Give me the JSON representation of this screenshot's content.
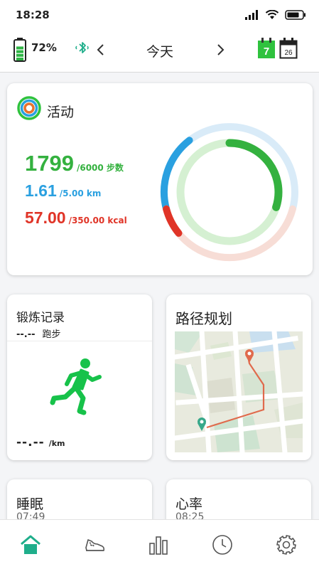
{
  "status": {
    "time": "18:28"
  },
  "header": {
    "battery_percent": "72%",
    "battery_level": 0.72,
    "title": "今天",
    "calendar_day": "7",
    "calendar_date": "26"
  },
  "activity": {
    "title": "活动",
    "steps": {
      "value": "1799",
      "goal": "/6000 步数",
      "fraction": 0.3
    },
    "distance": {
      "value": "1.61",
      "goal": "/5.00 km",
      "fraction": 0.32
    },
    "calories": {
      "value": "57.00",
      "goal": "/350.00 kcal",
      "fraction": 0.16
    }
  },
  "exercise": {
    "title": "锻炼记录",
    "time": "--.--",
    "type": "跑步",
    "pace": "--.--",
    "pace_unit": "/km"
  },
  "route": {
    "title": "路径规划"
  },
  "sleep": {
    "title": "睡眠",
    "value": "07:49"
  },
  "heart": {
    "title": "心率",
    "value": "08:25"
  },
  "colors": {
    "steps": "#34b13f",
    "distance": "#2aa0e0",
    "calories": "#e03427",
    "accent": "#1fae8b"
  }
}
